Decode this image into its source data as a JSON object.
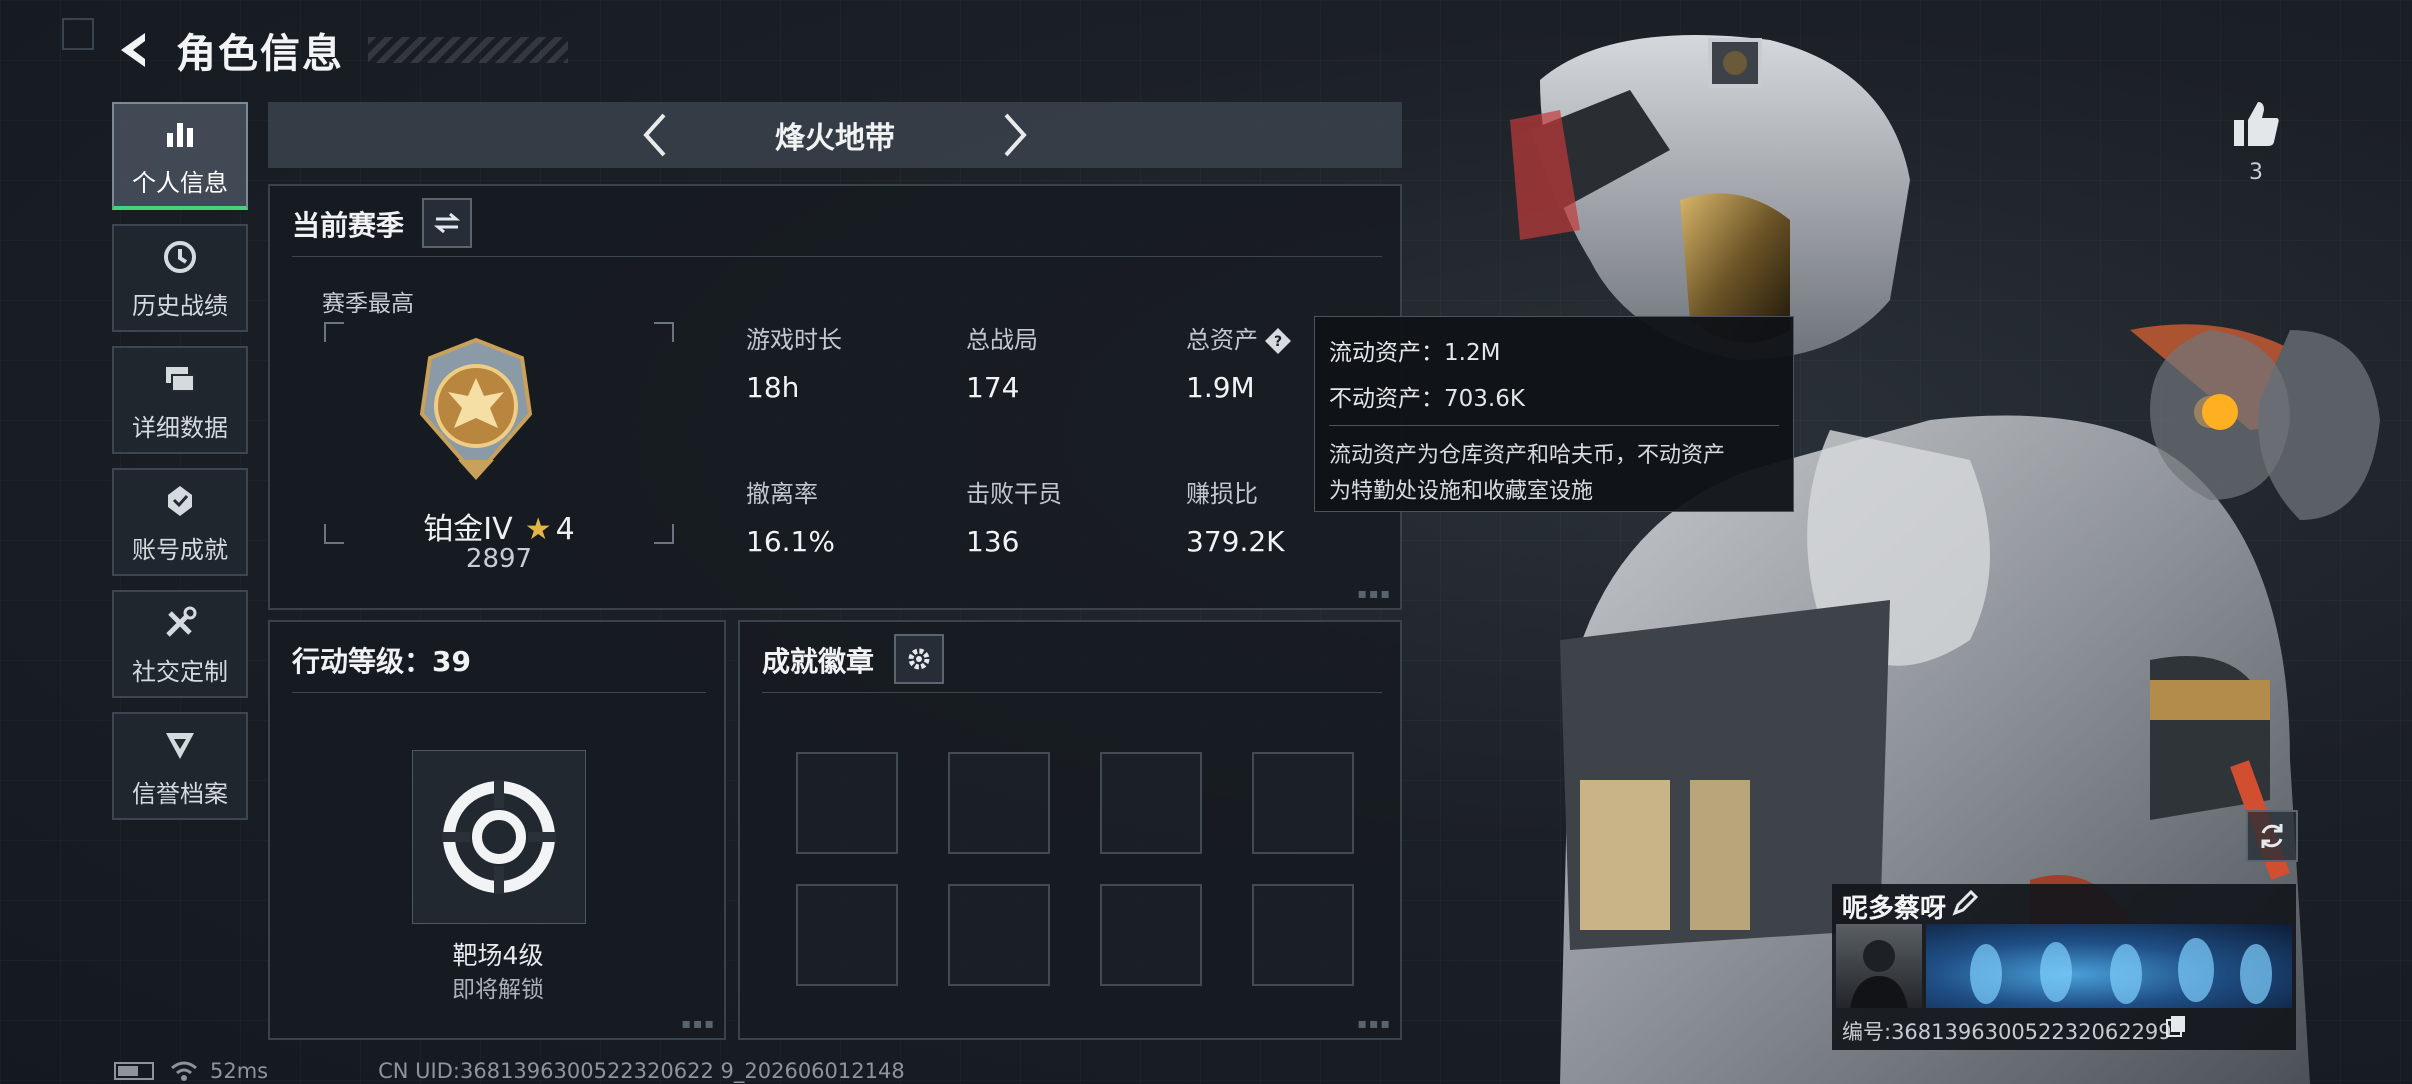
{
  "header": {
    "title": "角色信息"
  },
  "sidebar": {
    "items": [
      {
        "label": "个人信息",
        "icon": "bar-chart-icon"
      },
      {
        "label": "历史战绩",
        "icon": "history-icon"
      },
      {
        "label": "详细数据",
        "icon": "folder-icon"
      },
      {
        "label": "账号成就",
        "icon": "achievement-icon"
      },
      {
        "label": "社交定制",
        "icon": "tools-icon"
      },
      {
        "label": "信誉档案",
        "icon": "reputation-icon"
      }
    ]
  },
  "mode_selector": {
    "current": "烽火地带"
  },
  "season": {
    "title": "当前赛季",
    "best_label": "赛季最高",
    "rank_name": "铂金IV",
    "rank_stars": "4",
    "rank_score": "2897",
    "stats": {
      "play_time": {
        "label": "游戏时长",
        "value": "18h"
      },
      "total_matches": {
        "label": "总战局",
        "value": "174"
      },
      "total_assets": {
        "label": "总资产",
        "value": "1.9M"
      },
      "extract_rate": {
        "label": "撤离率",
        "value": "16.1%"
      },
      "operators_defeated": {
        "label": "击败干员",
        "value": "136"
      },
      "profit_loss": {
        "label": "赚损比",
        "value": "379.2K"
      }
    }
  },
  "assets_tooltip": {
    "liquid": "流动资产：1.2M",
    "fixed": "不动资产：703.6K",
    "description_line1": "流动资产为仓库资产和哈夫币，不动资产",
    "description_line2": "为特勤处设施和收藏室设施"
  },
  "action_level": {
    "title": "行动等级：39",
    "range_level": "靶场4级",
    "status": "即将解锁"
  },
  "badges": {
    "title": "成就徽章"
  },
  "profile": {
    "likes": "3",
    "name": "呢多蔡呀",
    "id_text": "编号:368139630052232062299"
  },
  "status_bar": {
    "ping": "52ms",
    "uid": "CN UID:3681396300522320622 9_202606012148"
  },
  "colors": {
    "accent_green": "#44d27a",
    "gold": "#e0b54a",
    "background": "#1b2026"
  }
}
